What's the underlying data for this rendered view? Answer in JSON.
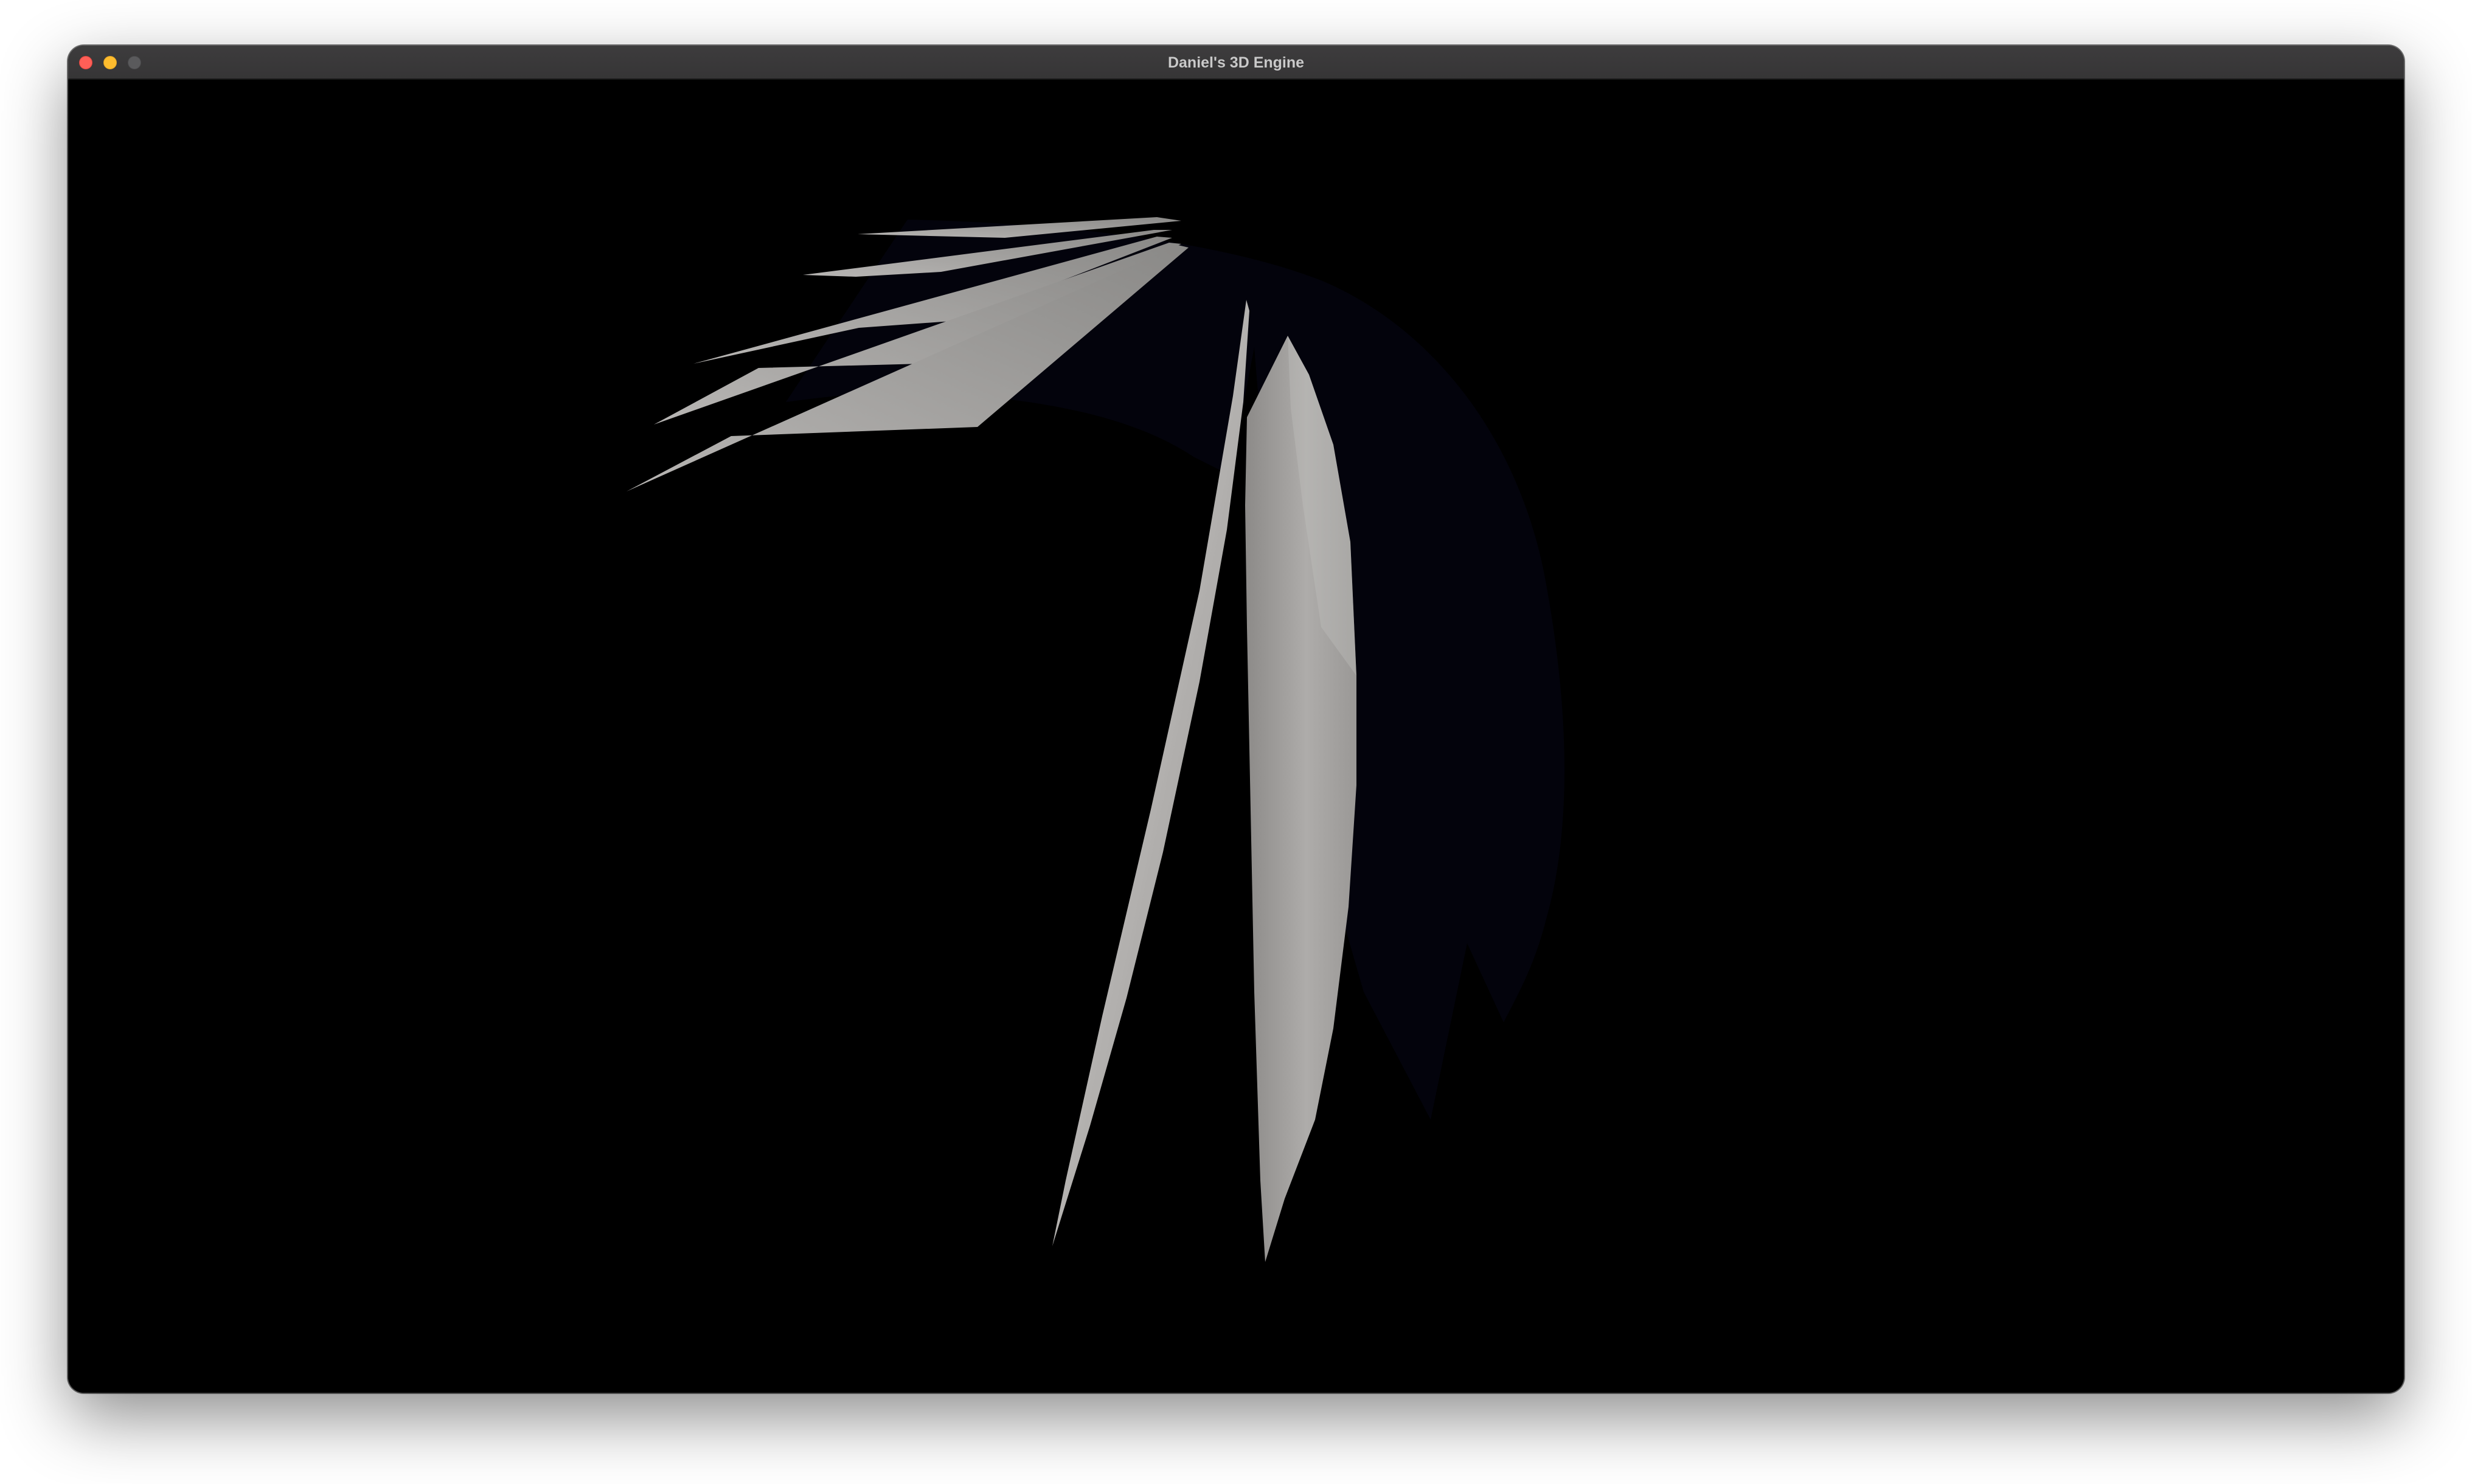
{
  "window": {
    "title": "Daniel's 3D Engine"
  },
  "controls": {
    "close": "close-icon",
    "minimize": "minimize-icon",
    "zoom": "zoom-icon"
  },
  "scene": {
    "background_color": "#000000",
    "shard_color": "#a8a6a4",
    "shadow_color": "#03030d"
  }
}
